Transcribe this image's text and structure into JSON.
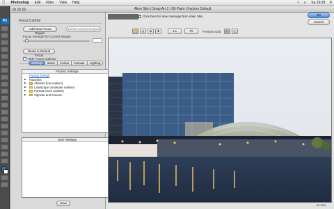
{
  "menubar": {
    "app": "Photoshop",
    "items": [
      "Edit",
      "Filter",
      "View",
      "Help"
    ],
    "clock": "Sa 19:29"
  },
  "window": {
    "title": "Alien Skin | Snap Art 2 | Oil Paint | Factory Default"
  },
  "toolbox": {
    "logo": "Ps"
  },
  "focus": {
    "section_title": "Focus Control",
    "add_region": "Add New Focus Region",
    "delete_region": "Delete Current Region",
    "strength_label": "Focus Strength for Current Region",
    "strength_value": "",
    "reset_button": "Reset to Default Focus",
    "hide_outlines": "Hide Focus Outlines"
  },
  "tabs": [
    {
      "label": "Settings",
      "active": true
    },
    {
      "label": "Basic",
      "active": false
    },
    {
      "label": "Colors",
      "active": false
    },
    {
      "label": "Canvas",
      "active": false
    },
    {
      "label": "Lighting",
      "active": false
    }
  ],
  "presets": {
    "header": "Factory Settings",
    "items": [
      {
        "label": "Factory Default",
        "selected": true,
        "folder": false
      },
      {
        "label": "Favorites",
        "selected": false,
        "folder": false
      },
      {
        "label": "Abstract (low realism)",
        "selected": false,
        "folder": true
      },
      {
        "label": "Landscape (moderate realism)",
        "selected": false,
        "folder": true
      },
      {
        "label": "Portrait (more realism)",
        "selected": false,
        "folder": true
      },
      {
        "label": "Vignette and Canvas",
        "selected": false,
        "folder": true
      }
    ]
  },
  "user": {
    "header": "User Settings",
    "save": "Save"
  },
  "header": {
    "news": "Click here for new message from Alien Skin",
    "zoom_fit": "1:1",
    "zoom_fill": "Fit",
    "preview_split_label": "Preview Split:",
    "ok": "OK",
    "cancel": "Cancel"
  },
  "status": {
    "zoom": "33.33%"
  }
}
